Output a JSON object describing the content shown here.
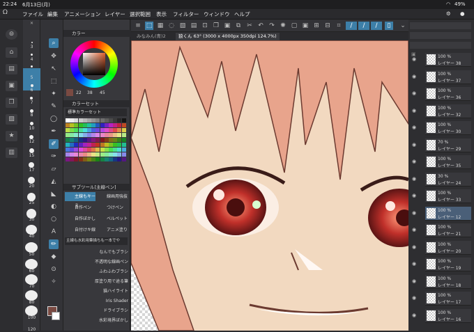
{
  "status": {
    "time": "22:24",
    "date": "6月13日(月)",
    "battery": "49%"
  },
  "menu": [
    "ファイル",
    "編集",
    "アニメーション",
    "レイヤー",
    "選択範囲",
    "表示",
    "フィルター",
    "ウィンドウ",
    "ヘルプ"
  ],
  "tabs": [
    {
      "label": "みなみん(青)2"
    },
    {
      "label": "狼くん 63° (3000 x 4000px 350dpi 124.7%)"
    }
  ],
  "brush_sizes": [
    "3",
    "4",
    "5",
    "6",
    "7",
    "8",
    "10",
    "12",
    "15",
    "17",
    "20",
    "25",
    "30",
    "40",
    "50",
    "60",
    "70",
    "80",
    "100",
    "120"
  ],
  "color_panel": {
    "header": "カラー",
    "values": [
      "22",
      "38",
      "45"
    ]
  },
  "color_set": {
    "header": "カラーセット",
    "selected": "標準カラーセット"
  },
  "subtool": {
    "header": "サブツール[主線ペン]",
    "items": [
      "主線もキーミ",
      "線画用強抜",
      "自作ペン",
      "つけペン",
      "自作ぼかし",
      "ベルペット",
      "自付けキ線",
      "アニメ塗り"
    ],
    "description": "主線も水彩用筆描ちも一本でや",
    "brushes": [
      "なんでもブラシ",
      "不透明な線画ペン",
      "ふわふわブラシ",
      "厚塗り用で途る筆",
      "猫ハイライト",
      "Iris Shader",
      "ドライブラシ",
      "水彩境界ぼかし"
    ]
  },
  "layers": [
    {
      "pct": "100 %",
      "name": "レイヤー 38"
    },
    {
      "pct": "100 %",
      "name": "レイヤー 37"
    },
    {
      "pct": "100 %",
      "name": "レイヤー 36"
    },
    {
      "pct": "100 %",
      "name": "レイヤー 32"
    },
    {
      "pct": "100 %",
      "name": "レイヤー 30"
    },
    {
      "pct": "70 %",
      "name": "レイヤー 29"
    },
    {
      "pct": "100 %",
      "name": "レイヤー 35"
    },
    {
      "pct": "30 %",
      "name": "レイヤー 24"
    },
    {
      "pct": "100 %",
      "name": "レイヤー 33"
    },
    {
      "pct": "100 %",
      "name": "レイヤー 12"
    },
    {
      "pct": "100 %",
      "name": "レイヤー 21"
    },
    {
      "pct": "100 %",
      "name": "レイヤー 20"
    },
    {
      "pct": "100 %",
      "name": "レイヤー 19"
    },
    {
      "pct": "100 %",
      "name": "レイヤー 18"
    },
    {
      "pct": "100 %",
      "name": "レイヤー 17"
    },
    {
      "pct": "100 %",
      "name": "レイヤー 16"
    }
  ],
  "colors": {
    "accent": "#3d7fa8",
    "hair": "#e8a48c",
    "skin": "#f2d9c0",
    "eye": "#c0302a",
    "line": "#5a2f2a"
  }
}
